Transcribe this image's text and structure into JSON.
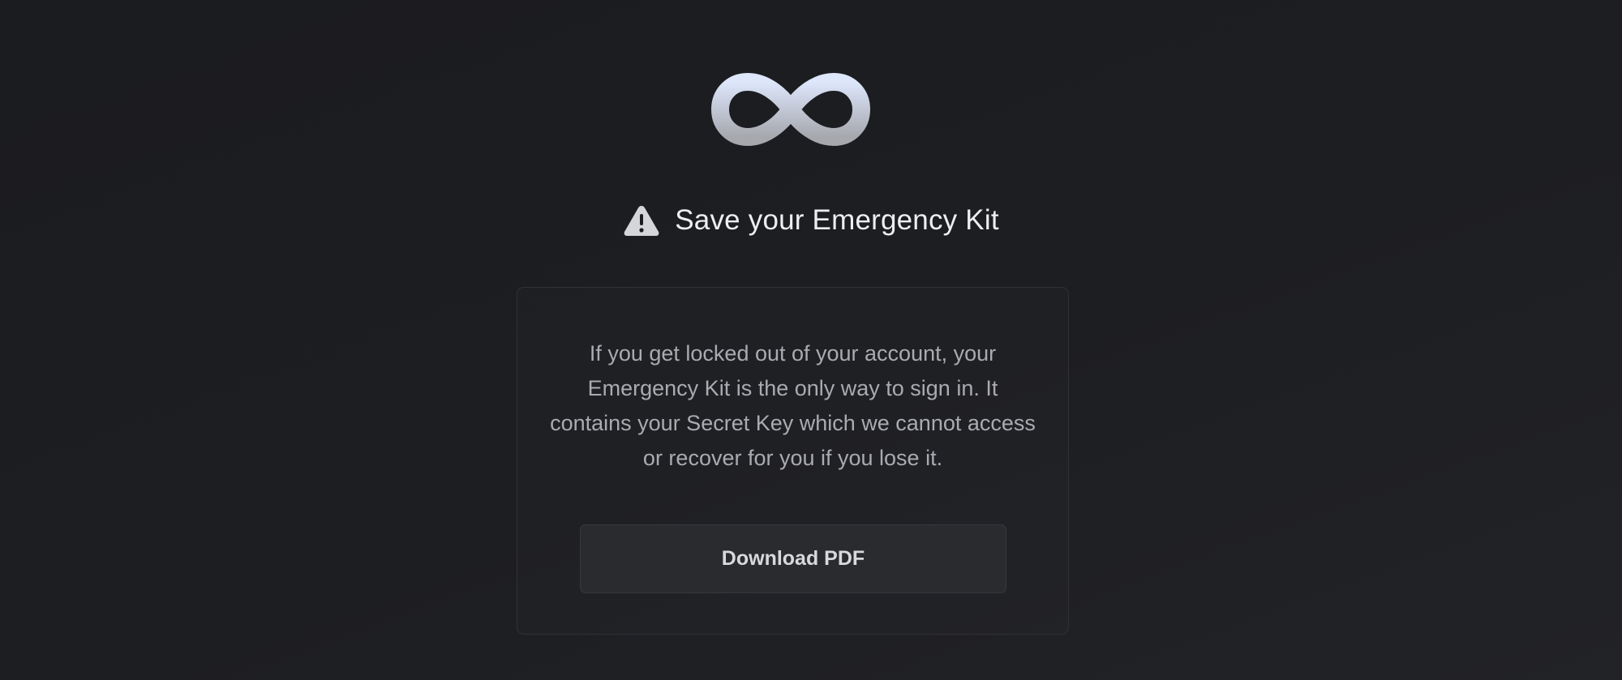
{
  "logo": {
    "icon": "infinity-logo-icon"
  },
  "header": {
    "icon": "warning-icon",
    "title": "Save your Emergency Kit"
  },
  "card": {
    "description": "If you get locked out of your account, your Emergency Kit is the only way to sign in. It contains your Secret Key which we cannot access or recover for you if you lose it.",
    "download_label": "Download PDF"
  },
  "colors": {
    "background": "#1d1e22",
    "card_border": "#303136",
    "button_background": "#2a2b2f",
    "heading_text": "#eceef1",
    "body_text": "#a9abb0"
  }
}
